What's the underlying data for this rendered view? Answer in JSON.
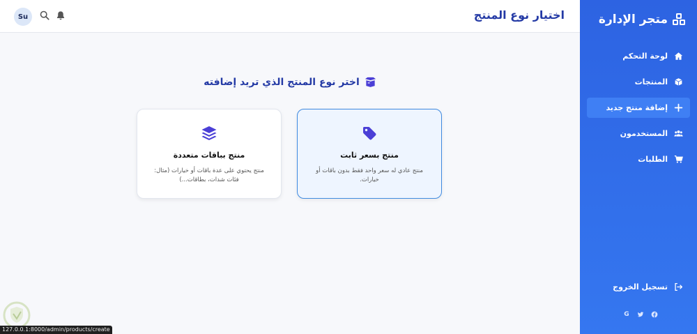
{
  "sidebar": {
    "brand": "متجر الإدارة",
    "brand_icon": "cubes-icon",
    "items": [
      {
        "label": "لوحة التحكم",
        "icon": "home-icon",
        "active": false
      },
      {
        "label": "المنتجات",
        "icon": "box-icon",
        "active": false
      },
      {
        "label": "إضافة منتج جديد",
        "icon": "plus-icon",
        "active": true
      },
      {
        "label": "المستخدمون",
        "icon": "users-icon",
        "active": false
      },
      {
        "label": "الطلبات",
        "icon": "cart-icon",
        "active": false
      }
    ],
    "logout": "تسجيل الخروج",
    "social": [
      "G",
      "twitter-icon",
      "facebook-icon"
    ]
  },
  "header": {
    "title": "اختيار نوع المنتج",
    "avatar": "Su",
    "icons": [
      "search-icon",
      "bell-icon"
    ]
  },
  "main": {
    "heading": "اختر نوع المنتج الذي تريد إضافته",
    "heading_icon": "box-open-icon",
    "cards": [
      {
        "title": "منتج بسعر ثابت",
        "description": "منتج عادي له سعر واحد فقط بدون باقات أو خيارات.",
        "icon": "tag-icon",
        "selected": true
      },
      {
        "title": "منتج بباقات متعددة",
        "description": "منتج يحتوي على عدة باقات أو خيارات (مثال: فئات شدات، بطاقات...)",
        "icon": "layers-icon",
        "selected": false
      }
    ]
  },
  "status_bar": "127.0.0.1:8000/admin/products/create",
  "colors": {
    "sidebar": "#2d63e2",
    "accent": "#243aa5",
    "icon": "#4b3fd6",
    "selected_border": "#3f8ae0"
  }
}
